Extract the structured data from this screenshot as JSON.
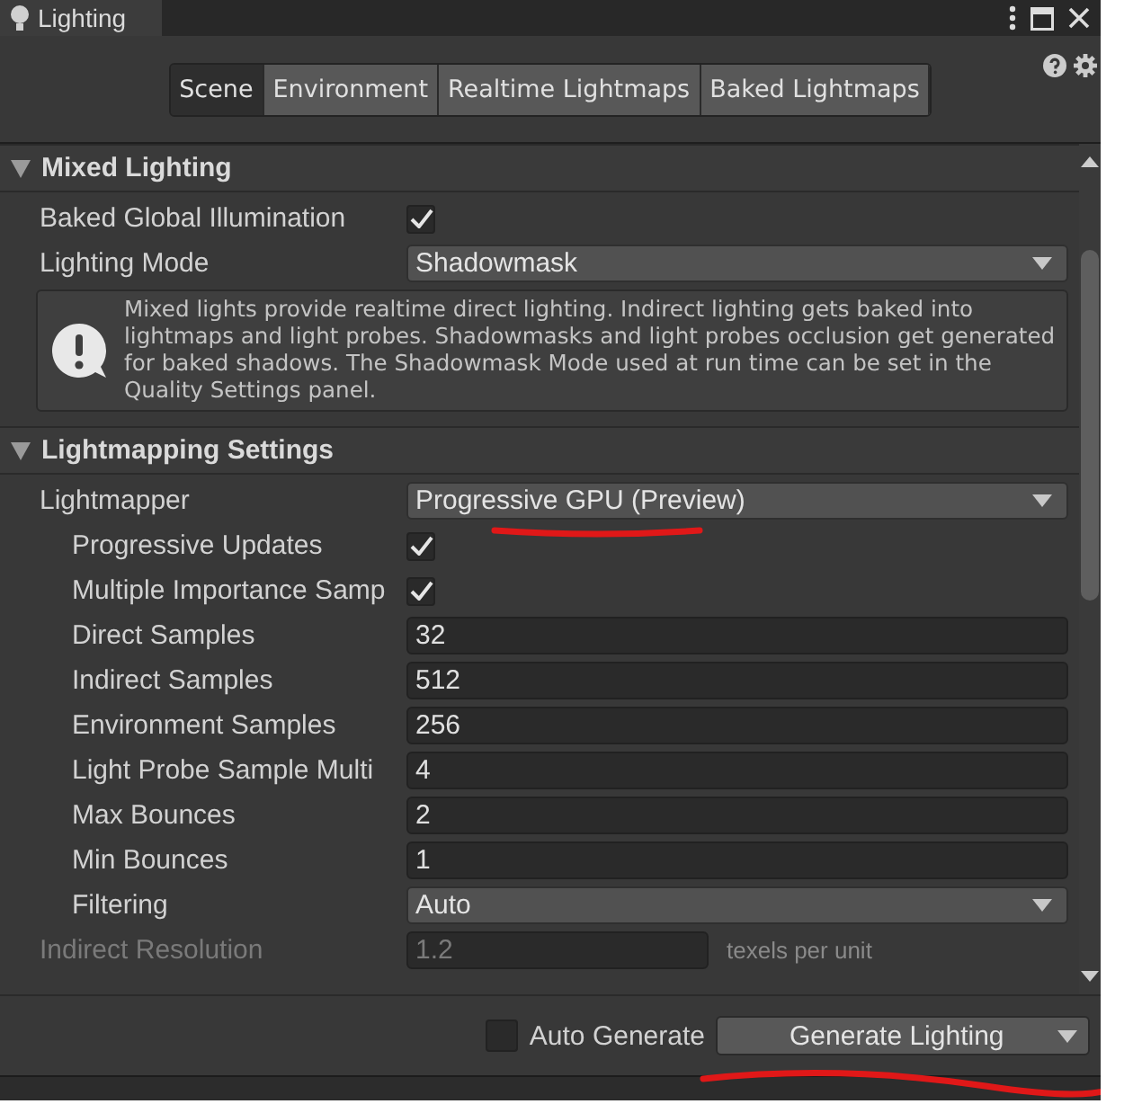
{
  "window": {
    "tab_title": "Lighting"
  },
  "tabs": [
    {
      "label": "Scene",
      "selected": true
    },
    {
      "label": "Environment",
      "selected": false
    },
    {
      "label": "Realtime Lightmaps",
      "selected": false
    },
    {
      "label": "Baked Lightmaps",
      "selected": false
    }
  ],
  "sections": [
    {
      "title": "Mixed Lighting",
      "expanded": true,
      "rows": [
        {
          "kind": "checkbox",
          "label": "Baked Global Illumination",
          "checked": true
        },
        {
          "kind": "dropdown",
          "label": "Lighting Mode",
          "value": "Shadowmask"
        },
        {
          "kind": "help",
          "text": "Mixed lights provide realtime direct lighting. Indirect lighting gets baked into lightmaps and light probes. Shadowmasks and light probes occlusion get generated for baked shadows. The Shadowmask Mode used at run time can be set in the Quality Settings panel."
        }
      ]
    },
    {
      "title": "Lightmapping Settings",
      "expanded": true,
      "rows": [
        {
          "kind": "dropdown",
          "label": "Lightmapper",
          "value": "Progressive GPU (Preview)",
          "children": [
            {
              "kind": "checkbox",
              "label": "Progressive Updates",
              "checked": true
            },
            {
              "kind": "checkbox",
              "label": "Multiple Importance Samp",
              "checked": true
            },
            {
              "kind": "number",
              "label": "Direct Samples",
              "value": "32"
            },
            {
              "kind": "number",
              "label": "Indirect Samples",
              "value": "512"
            },
            {
              "kind": "number",
              "label": "Environment Samples",
              "value": "256"
            },
            {
              "kind": "number",
              "label": "Light Probe Sample Multi",
              "value": "4"
            },
            {
              "kind": "number",
              "label": "Max Bounces",
              "value": "2"
            },
            {
              "kind": "number",
              "label": "Min Bounces",
              "value": "1"
            },
            {
              "kind": "dropdown",
              "label": "Filtering",
              "value": "Auto"
            }
          ]
        },
        {
          "kind": "number",
          "label": "Indirect Resolution",
          "value": "1.2",
          "disabled": true,
          "suffix": "texels per unit"
        }
      ]
    }
  ],
  "footer": {
    "auto_generate": {
      "label": "Auto Generate",
      "checked": false
    },
    "generate_button": "Generate Lighting"
  }
}
